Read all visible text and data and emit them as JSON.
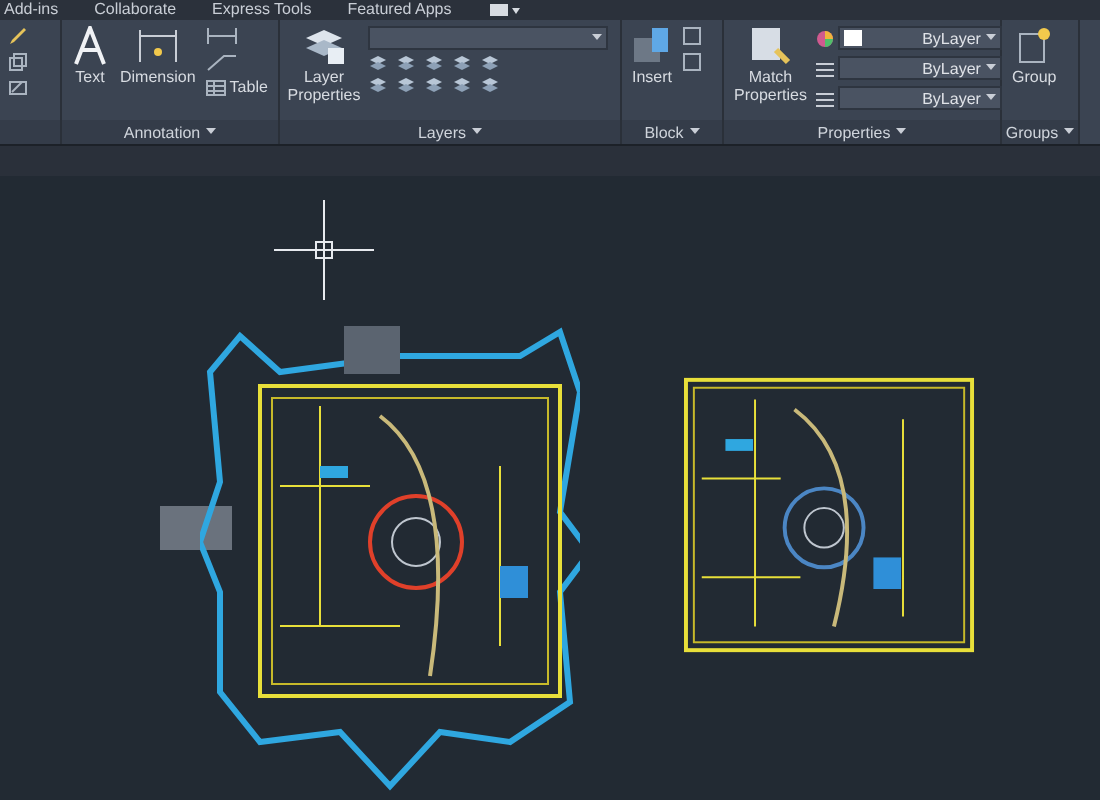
{
  "ribbon_tabs": [
    {
      "label": "Add-ins"
    },
    {
      "label": "Collaborate"
    },
    {
      "label": "Express Tools"
    },
    {
      "label": "Featured Apps"
    }
  ],
  "panels": [
    {
      "kind": "partial"
    },
    {
      "kind": "annotation",
      "title": "Annotation",
      "big_tools": [
        "Text",
        "Dimension"
      ],
      "small_tool": "Table"
    },
    {
      "kind": "layers",
      "title": "Layers",
      "big_tool": "Layer Properties"
    },
    {
      "kind": "block",
      "title": "Block",
      "big_tool": "Insert"
    },
    {
      "kind": "properties",
      "title": "Properties",
      "big_tool": "Match Properties",
      "dropdowns": [
        "ByLayer",
        "ByLayer",
        "ByLayer"
      ]
    },
    {
      "kind": "groups",
      "title": "Groups",
      "big_tool": "Group"
    }
  ]
}
